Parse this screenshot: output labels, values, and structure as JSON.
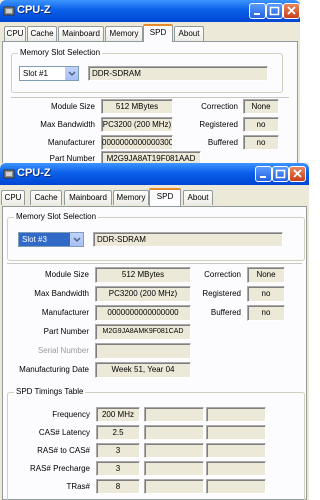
{
  "back": {
    "title": "CPU-Z",
    "tabs": [
      "CPU",
      "Cache",
      "Mainboard",
      "Memory",
      "SPD",
      "About"
    ],
    "active_tab": "SPD",
    "slot_group_title": "Memory Slot Selection",
    "slot_value": "Slot #1",
    "memory_type": "DDR-SDRAM",
    "rows": [
      {
        "label": "Module Size",
        "value": "512 MBytes",
        "rlabel": "Correction",
        "rvalue": "None"
      },
      {
        "label": "Max Bandwidth",
        "value": "PC3200 (200 MHz)",
        "rlabel": "Registered",
        "rvalue": "no"
      },
      {
        "label": "Manufacturer",
        "value": "0000000000000300",
        "rlabel": "Buffered",
        "rvalue": "no"
      }
    ],
    "part_label": "Part Number",
    "part_value": "M2G9JA8AT19F081AAD"
  },
  "front": {
    "title": "CPU-Z",
    "tabs": [
      "CPU",
      "Cache",
      "Mainboard",
      "Memory",
      "SPD",
      "About"
    ],
    "active_tab": "SPD",
    "slot_group_title": "Memory Slot Selection",
    "slot_value": "Slot #3",
    "memory_type": "DDR-SDRAM",
    "rows": [
      {
        "label": "Module Size",
        "value": "512 MBytes",
        "rlabel": "Correction",
        "rvalue": "None"
      },
      {
        "label": "Max Bandwidth",
        "value": "PC3200 (200 MHz)",
        "rlabel": "Registered",
        "rvalue": "no"
      },
      {
        "label": "Manufacturer",
        "value": "0000000000000000",
        "rlabel": "Buffered",
        "rvalue": "no"
      }
    ],
    "part_label": "Part Number",
    "part_value": "M2G9JA8AMK9F081CAD",
    "serial_label": "Serial Number",
    "serial_value": "",
    "mfg_date_label": "Manufacturing Date",
    "mfg_date_value": "Week 51, Year 04",
    "timings_title": "SPD Timings Table",
    "timings": [
      {
        "label": "Frequency",
        "value": "200 MHz"
      },
      {
        "label": "CAS# Latency",
        "value": "2.5"
      },
      {
        "label": "RAS# to CAS#",
        "value": "3"
      },
      {
        "label": "RAS# Precharge",
        "value": "3"
      },
      {
        "label": "TRas#",
        "value": "8"
      }
    ]
  },
  "colors": {
    "titlebar": "#0A5FE8",
    "panel": "#fcfcfe",
    "window": "#ECE9D8",
    "active_tab_accent": "#E68B2C",
    "combo_selected": "#3169C6"
  },
  "icons": [
    "cpuz-app-icon",
    "minimize-icon",
    "maximize-icon",
    "close-icon",
    "chevron-down-icon"
  ]
}
